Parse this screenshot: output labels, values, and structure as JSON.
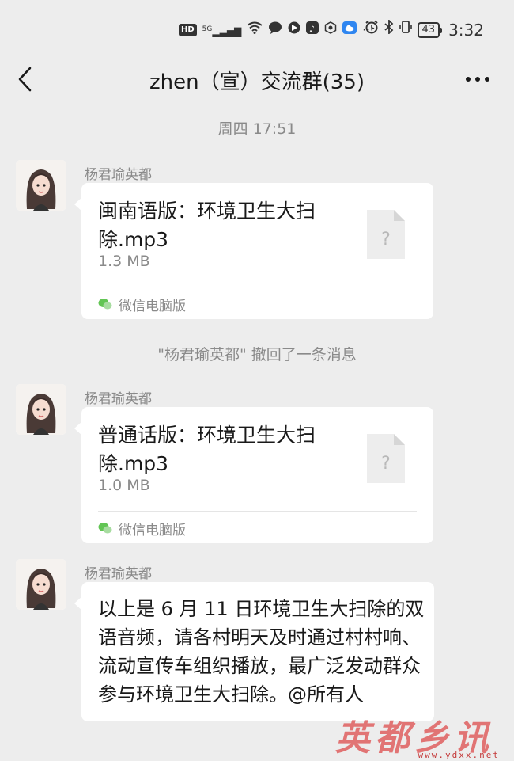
{
  "status_bar": {
    "network_hd": "HD",
    "signal": "5G",
    "battery": "43",
    "time": "3:32"
  },
  "header": {
    "title": "zhen（宣）交流群(35)",
    "back_icon": "chevron-left-icon",
    "more_icon": "more-dots-icon"
  },
  "chat": {
    "timestamp": "周四 17:51",
    "messages": [
      {
        "sender": "杨君瑜英都",
        "type": "file",
        "file_name": "闽南语版：环境卫生大扫除.mp3",
        "file_size": "1.3 MB",
        "source": "微信电脑版"
      },
      {
        "sender": "杨君瑜英都",
        "type": "file",
        "file_name": "普通话版：环境卫生大扫除.mp3",
        "file_size": "1.0 MB",
        "source": "微信电脑版"
      },
      {
        "sender": "杨君瑜英都",
        "type": "text",
        "text": "以上是 6 月 11 日环境卫生大扫除的双语音频，请各村明天及时通过村村响、流动宣传车组织播放，最广泛发动群众参与环境卫生大扫除。@所有人"
      }
    ],
    "recall_notice": "\"杨君瑜英都\" 撤回了一条消息"
  },
  "watermark": {
    "text": "英都乡讯",
    "url": "www.ydxx.net"
  },
  "colors": {
    "background": "#ededed",
    "bubble": "#ffffff",
    "meta_text": "#8a8a8a",
    "watermark": "#e06060"
  }
}
